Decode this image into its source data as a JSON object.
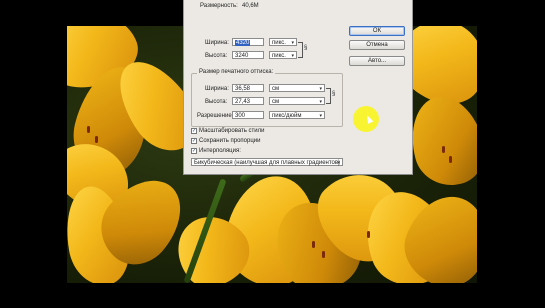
{
  "dialog": {
    "dimensions_label": "Размерность:",
    "dimensions_value": "40,6M",
    "pixel": {
      "width_label": "Ширина:",
      "width_value": "4320",
      "width_unit": "пикс.",
      "height_label": "Высота:",
      "height_value": "3240",
      "height_unit": "пикс."
    },
    "print": {
      "group_title": "Размер печатного оттиска:",
      "width_label": "Ширина:",
      "width_value": "36,58",
      "width_unit": "см",
      "height_label": "Высота:",
      "height_value": "27,43",
      "height_unit": "см",
      "resolution_label": "Разрешение:",
      "resolution_value": "300",
      "resolution_unit": "пикс/дюйм"
    },
    "options": {
      "scale_styles": "Масштабировать стили",
      "constrain": "Сохранить пропорции",
      "resample": "Интерполяция:",
      "resample_method": "Бикубическая (наилучшая для плавных градиентов)"
    },
    "buttons": {
      "ok": "ОК",
      "cancel": "Отмена",
      "auto": "Авто..."
    }
  },
  "colors": {
    "selection": "#3163c5",
    "cursor_highlight": "#faf428"
  }
}
